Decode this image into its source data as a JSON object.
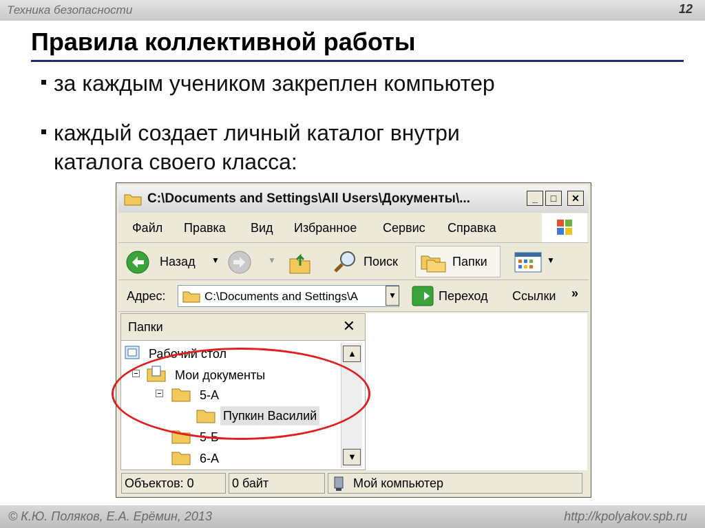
{
  "slide": {
    "section": "Техника безопасности",
    "number": "12",
    "title": "Правила коллективной работы",
    "bullets": [
      "за каждым учеником закреплен компьютер",
      "каждый создает личный каталог внутри",
      "каталога своего класса:"
    ],
    "footer_left": "© К.Ю. Поляков, Е.А. Ерёмин, 2013",
    "footer_right": "http://kpolyakov.spb.ru",
    "accent_color": "#1a2a7a",
    "highlight_color": "#e01f1f"
  },
  "window": {
    "title": "C:\\Documents and Settings\\All Users\\Документы\\...",
    "controls": {
      "minimize": "_",
      "maximize": "□",
      "close": "✕"
    },
    "menu": [
      "Файл",
      "Правка",
      "Вид",
      "Избранное",
      "Сервис",
      "Справка"
    ],
    "toolbar": {
      "back": "Назад",
      "search": "Поиск",
      "folders": "Папки"
    },
    "address": {
      "label": "Адрес:",
      "value": "C:\\Documents and Settings\\A",
      "go": "Переход",
      "links": "Ссылки",
      "more": "»"
    },
    "folders_panel": {
      "title": "Папки",
      "close": "✕",
      "tree": [
        "Рабочий стол",
        "Мои документы",
        "5-А",
        "Пупкин Василий",
        "5-Б",
        "6-А"
      ]
    },
    "status": {
      "objects": "Объектов: 0",
      "size": "0 байт",
      "location": "Мой компьютер"
    }
  }
}
